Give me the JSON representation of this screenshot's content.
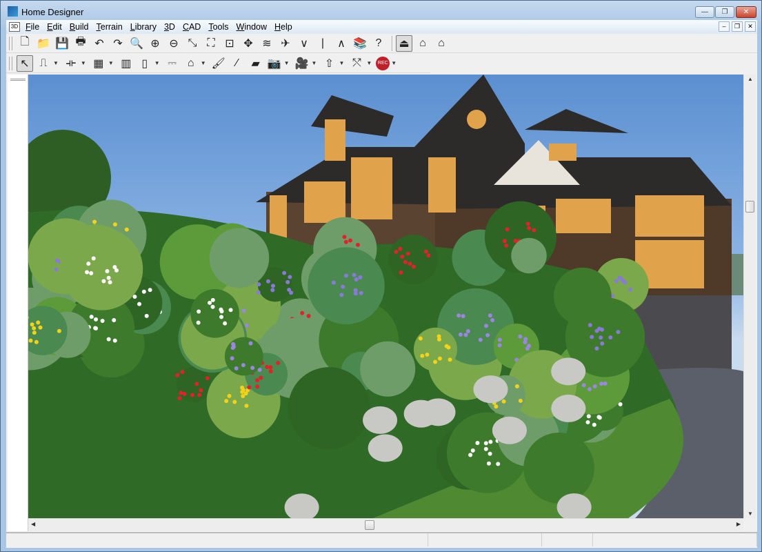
{
  "window": {
    "title": "Home Designer",
    "minimize": "—",
    "maximize": "❐",
    "close": "✕"
  },
  "menu": {
    "items": [
      "File",
      "Edit",
      "Build",
      "Terrain",
      "Library",
      "3D",
      "CAD",
      "Tools",
      "Window",
      "Help"
    ]
  },
  "toolbar1": [
    {
      "name": "new-icon",
      "glyph": "🗋"
    },
    {
      "name": "open-folder-icon",
      "glyph": "📁"
    },
    {
      "name": "save-icon",
      "glyph": "💾"
    },
    {
      "name": "print-icon",
      "glyph": "🖶"
    },
    {
      "name": "undo-icon",
      "glyph": "↶"
    },
    {
      "name": "redo-icon",
      "glyph": "↷"
    },
    {
      "name": "zoom-icon",
      "glyph": "🔍"
    },
    {
      "name": "zoom-in-icon",
      "glyph": "⊕"
    },
    {
      "name": "zoom-out-icon",
      "glyph": "⊖"
    },
    {
      "name": "zoom-window-icon",
      "glyph": "⤡"
    },
    {
      "name": "fill-window-icon",
      "glyph": "⛶"
    },
    {
      "name": "fill-window-building-icon",
      "glyph": "⊡"
    },
    {
      "name": "pan-icon",
      "glyph": "✥"
    },
    {
      "name": "layers-icon",
      "glyph": "≋"
    },
    {
      "name": "send-icon",
      "glyph": "✈"
    },
    {
      "name": "down-floor-icon",
      "glyph": "∨"
    },
    {
      "name": "floor-icon",
      "glyph": "|"
    },
    {
      "name": "up-floor-icon",
      "glyph": "∧"
    },
    {
      "name": "library-icon",
      "glyph": "📚"
    },
    {
      "name": "help-icon",
      "glyph": "?"
    }
  ],
  "toolbar1_views": [
    {
      "name": "floor-plan-view-icon",
      "glyph": "⏏"
    },
    {
      "name": "elevation-view-icon",
      "glyph": "⌂"
    },
    {
      "name": "3d-view-icon",
      "glyph": "⌂"
    }
  ],
  "toolbar2": [
    {
      "name": "select-arrow-icon",
      "glyph": "↖",
      "active": true
    },
    {
      "name": "wall-tool-icon",
      "glyph": "⎍",
      "dropdown": true
    },
    {
      "name": "dimension-icon",
      "glyph": "⟛",
      "dropdown": true
    },
    {
      "name": "cabinet-icon",
      "glyph": "▦",
      "dropdown": true
    },
    {
      "name": "fireplace-icon",
      "glyph": "▥"
    },
    {
      "name": "door-icon",
      "glyph": "▯",
      "dropdown": true
    },
    {
      "name": "electrical-icon",
      "glyph": "⎓"
    },
    {
      "name": "house-icon",
      "glyph": "⌂",
      "dropdown": true
    },
    {
      "name": "paint-icon",
      "glyph": "🖌"
    },
    {
      "name": "eyedropper-icon",
      "glyph": "⁄"
    },
    {
      "name": "material-icon",
      "glyph": "▰"
    },
    {
      "name": "camera-icon",
      "glyph": "📷",
      "dropdown": true
    },
    {
      "name": "walkthrough-camera-icon",
      "glyph": "🎥",
      "dropdown": true
    },
    {
      "name": "up-arrow-icon",
      "glyph": "⇧",
      "dropdown": true
    },
    {
      "name": "terrain-tool-icon",
      "glyph": "⤲",
      "dropdown": true
    },
    {
      "name": "record-icon",
      "glyph": "REC",
      "dropdown": true
    }
  ],
  "colors": {
    "titlebar": "#c4d9ef",
    "record": "#c0202a",
    "sky": "#7aa7dc",
    "house": "#5a4330",
    "roof": "#2d2b2a",
    "grass": "#4f8a33"
  },
  "status": {
    "cells": [
      "",
      "",
      "",
      ""
    ]
  }
}
